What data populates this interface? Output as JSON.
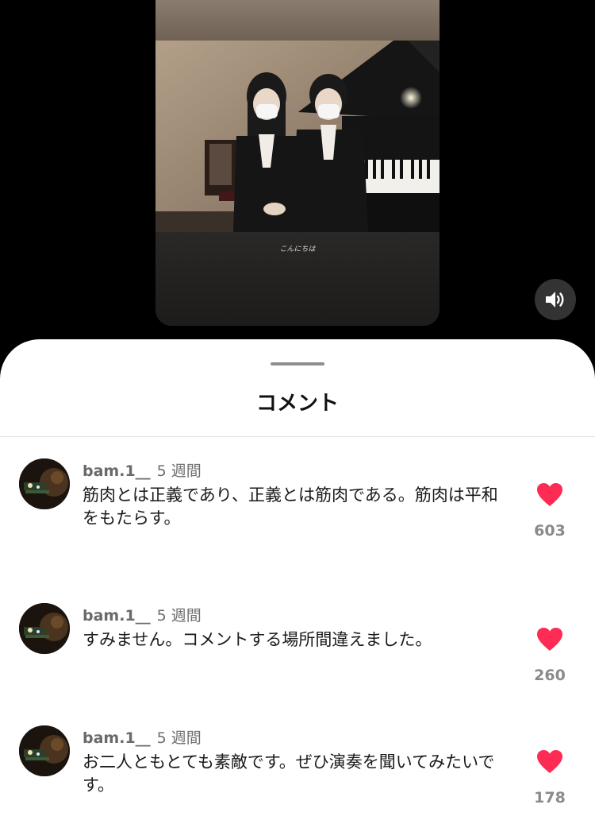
{
  "video": {
    "caption": "こんにちは",
    "sound_icon": "speaker-on-icon"
  },
  "sheet": {
    "title": "コメント"
  },
  "comments": [
    {
      "username": "bam.1__",
      "time": "5 週間",
      "text": "筋肉とは正義であり、正義とは筋肉である。筋肉は平和をもたらす。",
      "likes": "603",
      "liked": true
    },
    {
      "username": "bam.1__",
      "time": "5 週間",
      "text": "すみません。コメントする場所間違えました。",
      "likes": "260",
      "liked": true
    },
    {
      "username": "bam.1__",
      "time": "5 週間",
      "text": "お二人ともとても素敵です。ぜひ演奏を聞いてみたいです。",
      "likes": "178",
      "liked": true
    }
  ],
  "colors": {
    "like_red": "#fe2c55",
    "background": "#000000",
    "sheet": "#ffffff"
  }
}
